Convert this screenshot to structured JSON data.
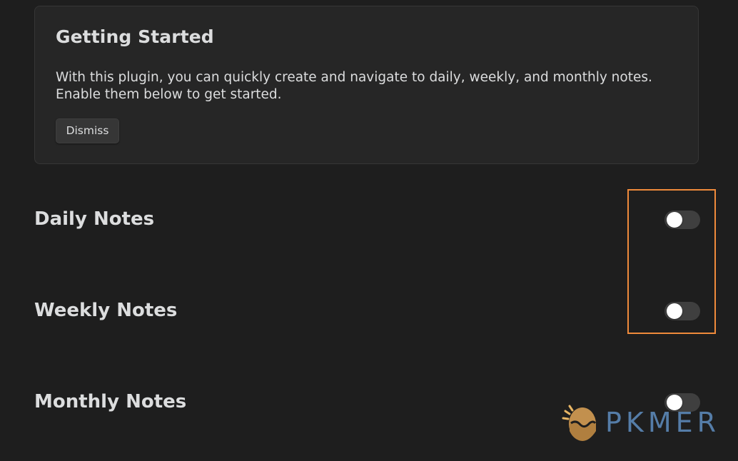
{
  "getting_started": {
    "title": "Getting Started",
    "description": "With this plugin, you can quickly create and navigate to daily, weekly, and monthly notes. Enable them below to get started.",
    "dismiss_label": "Dismiss"
  },
  "settings": [
    {
      "label": "Daily Notes",
      "enabled": false
    },
    {
      "label": "Weekly Notes",
      "enabled": false
    },
    {
      "label": "Monthly Notes",
      "enabled": false
    }
  ],
  "annotation": {
    "color": "#ef8a3b"
  },
  "watermark": {
    "text": "PKMER",
    "text_color": "#5b88b8"
  },
  "colors": {
    "background": "#1e1e1e",
    "card_background": "#262626",
    "toggle_off": "#3f3f3f",
    "text": "#dcddde"
  }
}
